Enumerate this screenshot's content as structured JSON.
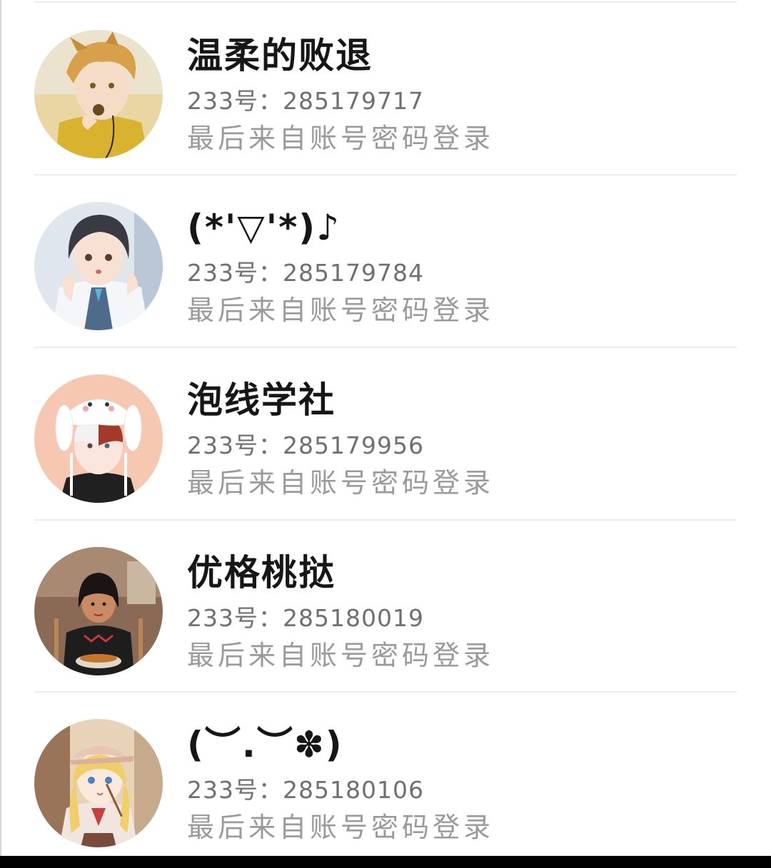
{
  "accounts": [
    {
      "nickname": "温柔的败退",
      "id_prefix": "233号：",
      "id": "285179717",
      "status": "最后来自账号密码登录",
      "avatar_icon": "anime-boy-blonde-avatar"
    },
    {
      "nickname": "(*'▽'*)♪",
      "id_prefix": "233号：",
      "id": "285179784",
      "status": "最后来自账号密码登录",
      "avatar_icon": "anime-girl-school-uniform-avatar"
    },
    {
      "nickname": "泡线学社",
      "id_prefix": "233号：",
      "id": "285179956",
      "status": "最后来自账号密码登录",
      "avatar_icon": "anime-boy-bunny-hat-avatar"
    },
    {
      "nickname": "优格桃挞",
      "id_prefix": "233号：",
      "id": "285180019",
      "status": "最后来自账号密码登录",
      "avatar_icon": "girl-eating-noodles-avatar"
    },
    {
      "nickname": "(︶.︶✽)",
      "id_prefix": "233号：",
      "id": "285180106",
      "status": "最后来自账号密码登录",
      "avatar_icon": "anime-girl-cap-avatar"
    }
  ],
  "colors": {
    "nickname": "#161616",
    "id_text": "#707070",
    "status_text": "#9a9a9a",
    "divider": "#ececec",
    "background": "#ffffff"
  }
}
